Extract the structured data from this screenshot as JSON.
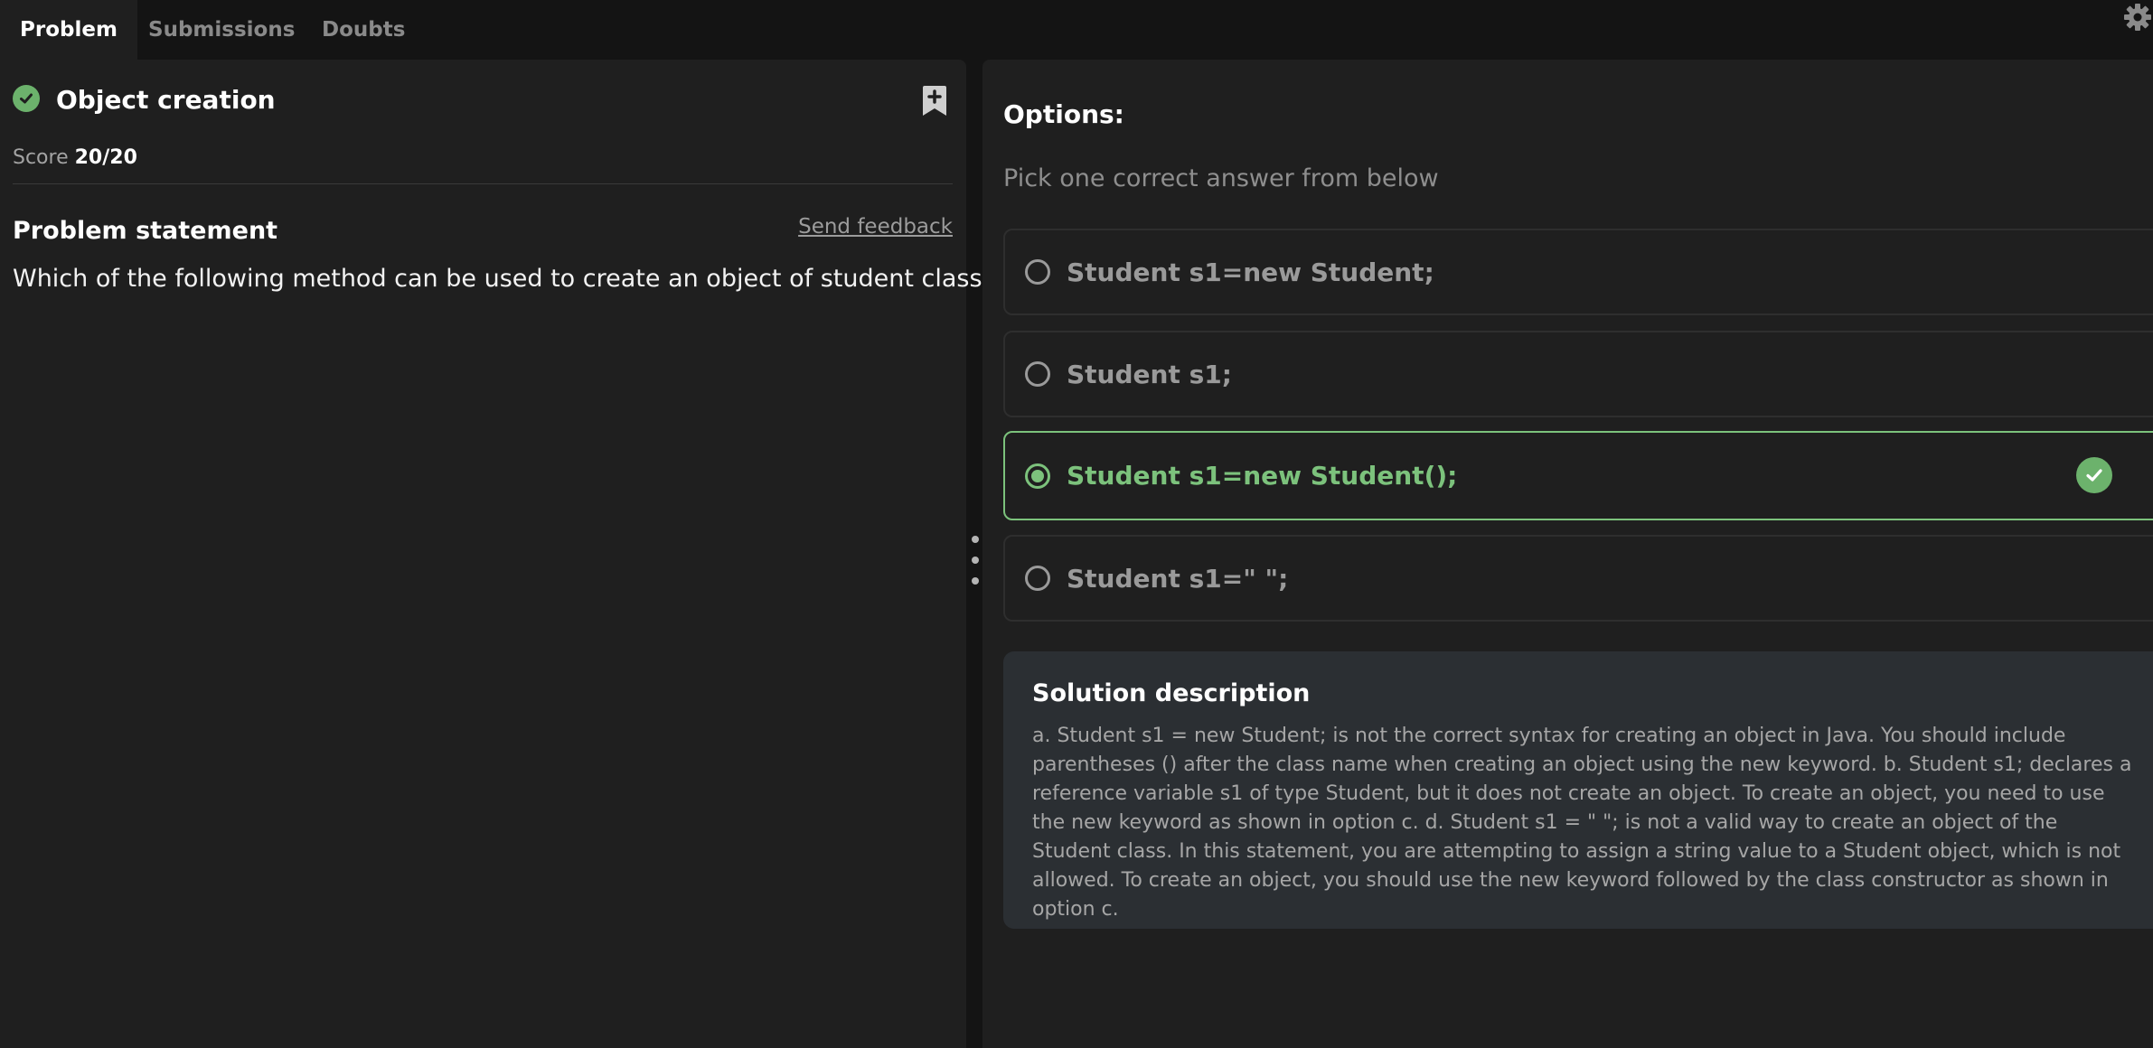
{
  "tabs": [
    {
      "label": "Problem",
      "active": true
    },
    {
      "label": "Submissions",
      "active": false
    },
    {
      "label": "Doubts",
      "active": false
    }
  ],
  "settings": {
    "icon": "gear-icon"
  },
  "problem": {
    "title": "Object creation",
    "status_icon": "check-circle-icon",
    "score_label": "Score",
    "score_value": "20/20",
    "bookmark_icon": "bookmark-plus-icon",
    "statement_heading": "Problem statement",
    "feedback_label": "Send feedback",
    "statement": "Which of the following method can be used to create an object of student class?"
  },
  "options": {
    "heading": "Options:",
    "hint": "Pick one correct answer from below",
    "items": [
      {
        "label": "Student s1=new Student;",
        "selected": false,
        "correct": false
      },
      {
        "label": "Student s1;",
        "selected": false,
        "correct": false
      },
      {
        "label": "Student s1=new Student();",
        "selected": true,
        "correct": true
      },
      {
        "label": "Student s1=\" \";",
        "selected": false,
        "correct": false
      }
    ]
  },
  "solution": {
    "heading": "Solution description",
    "text": "a. Student s1 = new Student; is not the correct syntax for creating an object in Java. You should include parentheses () after the class name when creating an object using the new keyword. b. Student s1; declares a reference variable s1 of type Student, but it does not create an object. To create an object, you need to use the new keyword as shown in option c. d. Student s1 = \" \"; is not a valid way to create an object of the Student class. In this statement, you are attempting to assign a string value to a Student object, which is not allowed. To create an object, you should use the new keyword followed by the class constructor as shown in option c."
  },
  "colors": {
    "accent_green": "#7cc27c",
    "panel_bg": "#1f1f1f",
    "page_bg": "#141414",
    "solution_bg": "#2b2f33"
  }
}
